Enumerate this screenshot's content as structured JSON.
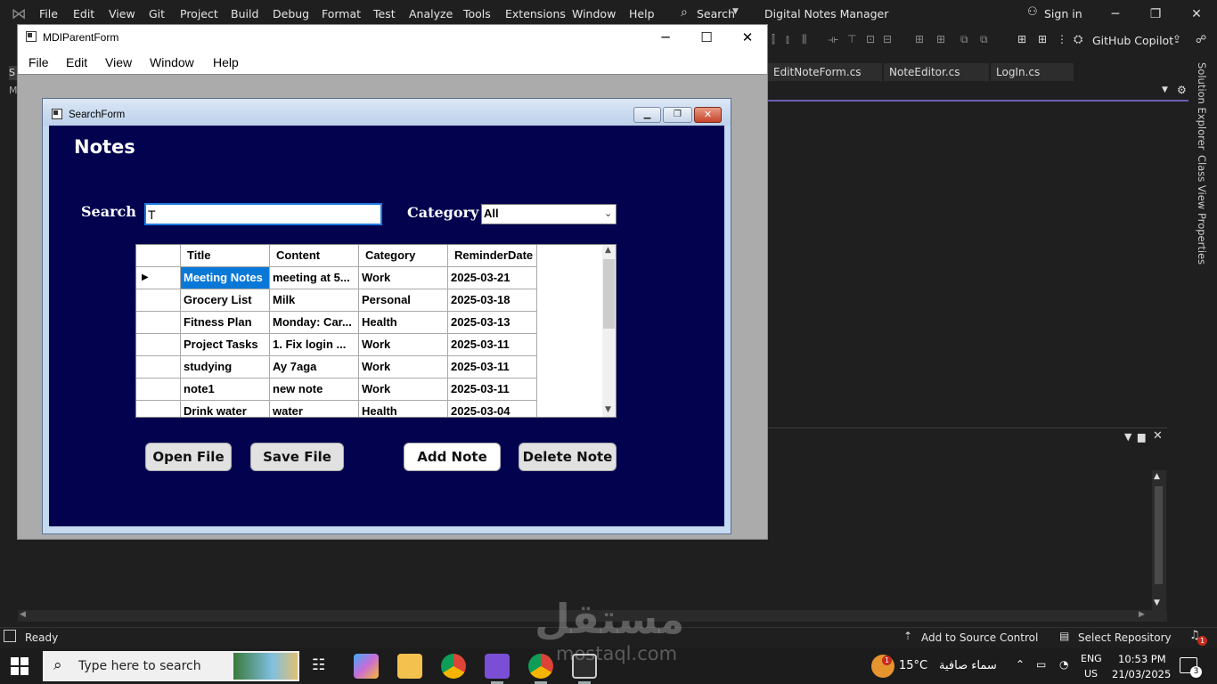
{
  "vs": {
    "menu": [
      "File",
      "Edit",
      "View",
      "Git",
      "Project",
      "Build",
      "Debug",
      "Format",
      "Test",
      "Analyze",
      "Tools",
      "Extensions",
      "Window",
      "Help"
    ],
    "search_label": "Search",
    "app_title": "Digital Notes Manager",
    "signin": "Sign in",
    "copilot": "GitHub Copilot",
    "doc_tabs": [
      "EditNoteForm.cs",
      "NoteEditor.cs",
      "LogIn.cs"
    ],
    "side_panels": [
      "Solution Explorer",
      "Class View",
      "Properties"
    ],
    "left_tab_1": "S",
    "left_tab_2": "M",
    "status": {
      "ready": "Ready",
      "source_control": "Add to Source Control",
      "repository": "Select Repository",
      "notification_count": "1"
    },
    "accent_color": "#6b5fb5"
  },
  "taskbar": {
    "search_placeholder": "Type here to search",
    "weather_badge": "1",
    "temperature": "15°C",
    "weather_desc": "سماء صافية",
    "lang_line1": "ENG",
    "lang_line2": "US",
    "time": "10:53 PM",
    "date": "21/03/2025",
    "notification_count": "3"
  },
  "watermark": {
    "arabic": "مستقل",
    "latin": "mostaql.com"
  },
  "mdi": {
    "title": "MDIParentForm",
    "menu": [
      "File",
      "Edit",
      "View",
      "Window",
      "Help"
    ]
  },
  "search_form": {
    "title": "SearchForm",
    "heading": "Notes",
    "search_label": "Search",
    "search_value": "T",
    "category_label": "Category",
    "category_value": "All",
    "background_color": "#02024f",
    "grid": {
      "columns": [
        "Title",
        "Content",
        "Category",
        "ReminderDate"
      ],
      "rows": [
        [
          "Meeting Notes",
          "meeting at 5...",
          "Work",
          "2025-03-21"
        ],
        [
          "Grocery List",
          "Milk",
          "Personal",
          "2025-03-18"
        ],
        [
          "Fitness Plan",
          "Monday: Car...",
          "Health",
          "2025-03-13"
        ],
        [
          "Project Tasks",
          "1. Fix login ...",
          "Work",
          "2025-03-11"
        ],
        [
          "studying",
          "Ay 7aga",
          "Work",
          "2025-03-11"
        ],
        [
          "note1",
          "new note",
          "Work",
          "2025-03-11"
        ],
        [
          "Drink water",
          "water",
          "Health",
          "2025-03-04"
        ]
      ],
      "selected_row": 0
    },
    "buttons": {
      "open_file": "Open File",
      "save_file": "Save File",
      "add_note": "Add Note",
      "delete_note": "Delete Note"
    }
  }
}
